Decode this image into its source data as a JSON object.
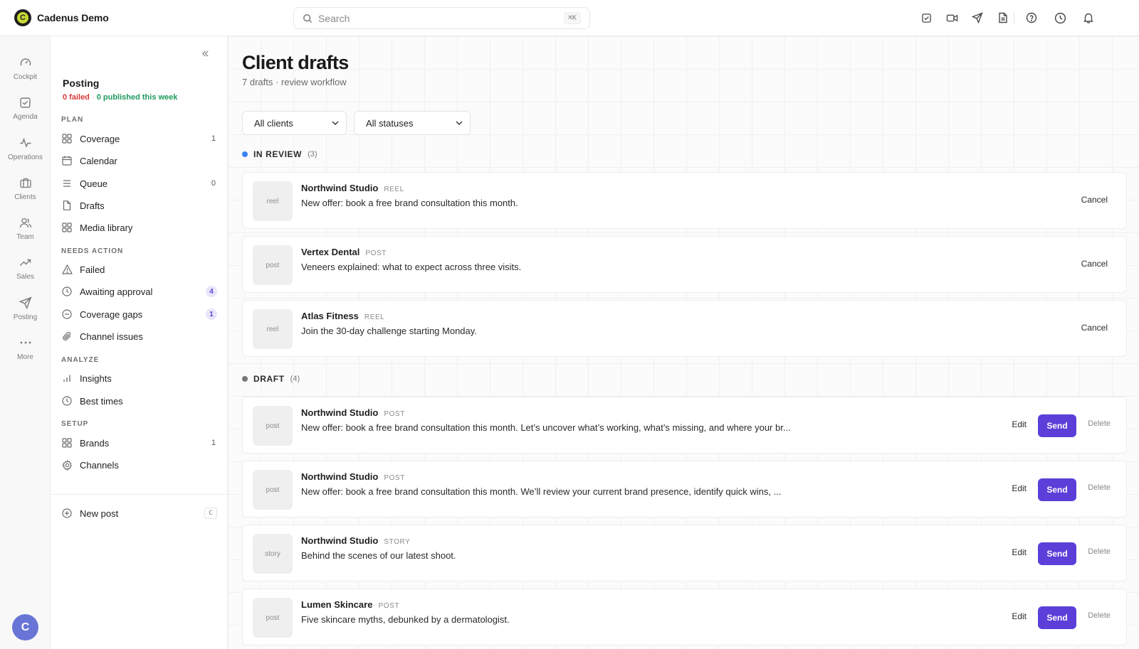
{
  "app": {
    "name": "Cadenus Demo",
    "logo_letter": "C",
    "accent": "#5b3fd8"
  },
  "search": {
    "placeholder": "Search",
    "shortcut": "⌘K"
  },
  "topbar_icons": [
    "checkbox-icon",
    "video-icon",
    "send-icon",
    "document-icon",
    "help-icon",
    "clock-icon",
    "bell-icon"
  ],
  "rail": {
    "items": [
      {
        "label": "Cockpit",
        "icon": "gauge-icon"
      },
      {
        "label": "Agenda",
        "icon": "checkbox-icon"
      },
      {
        "label": "Operations",
        "icon": "activity-icon"
      },
      {
        "label": "Clients",
        "icon": "briefcase-icon"
      },
      {
        "label": "Team",
        "icon": "users-icon"
      },
      {
        "label": "Sales",
        "icon": "trending-up-icon"
      },
      {
        "label": "Posting",
        "icon": "send-icon"
      },
      {
        "label": "More",
        "icon": "more-icon"
      }
    ],
    "avatar": "C"
  },
  "sidebar": {
    "title": "Posting",
    "failed": "0 failed",
    "separator": "·",
    "published": "0 published this week",
    "sections": [
      {
        "heading": "PLAN",
        "items": [
          {
            "label": "Coverage",
            "icon": "grid-icon",
            "count": "1"
          },
          {
            "label": "Calendar",
            "icon": "calendar-icon",
            "count": ""
          },
          {
            "label": "Queue",
            "icon": "list-icon",
            "count": "0"
          },
          {
            "label": "Drafts",
            "icon": "file-icon",
            "count": ""
          },
          {
            "label": "Media library",
            "icon": "grid-icon",
            "count": ""
          }
        ]
      },
      {
        "heading": "NEEDS ACTION",
        "items": [
          {
            "label": "Failed",
            "icon": "warning-icon",
            "count": ""
          },
          {
            "label": "Awaiting approval",
            "icon": "clock-icon",
            "count": "4"
          },
          {
            "label": "Coverage gaps",
            "icon": "minus-circle-icon",
            "count": "1"
          },
          {
            "label": "Channel issues",
            "icon": "paperclip-icon",
            "count": ""
          }
        ]
      },
      {
        "heading": "ANALYZE",
        "items": [
          {
            "label": "Insights",
            "icon": "bar-chart-icon",
            "count": ""
          },
          {
            "label": "Best times",
            "icon": "clock-icon",
            "count": ""
          }
        ]
      },
      {
        "heading": "SETUP",
        "items": [
          {
            "label": "Brands",
            "icon": "grid-icon",
            "count": "1"
          },
          {
            "label": "Channels",
            "icon": "gear-icon",
            "count": ""
          }
        ]
      }
    ],
    "new_post": {
      "label": "New post",
      "shortcut": "C"
    }
  },
  "main": {
    "title": "Client drafts",
    "subtitle": "7 drafts · review workflow",
    "filters": [
      {
        "value": "All clients"
      },
      {
        "value": "All statuses"
      }
    ],
    "groups": [
      {
        "label": "IN REVIEW",
        "count": "(3)",
        "dot_color": "#3b82f6",
        "items": [
          {
            "thumb": "reel",
            "client": "Northwind Studio",
            "type": "REEL",
            "text": "New offer: book a free brand consultation this month.",
            "action": "Cancel"
          },
          {
            "thumb": "post",
            "client": "Vertex Dental",
            "type": "POST",
            "text": "Veneers explained: what to expect across three visits.",
            "action": "Cancel"
          },
          {
            "thumb": "reel",
            "client": "Atlas Fitness",
            "type": "REEL",
            "text": "Join the 30-day challenge starting Monday.",
            "action": "Cancel"
          }
        ]
      },
      {
        "label": "DRAFT",
        "count": "(4)",
        "dot_color": "#777777",
        "items": [
          {
            "thumb": "post",
            "client": "Northwind Studio",
            "type": "POST",
            "text": "New offer: book a free brand consultation this month. Let’s uncover what’s working, what’s missing, and where your br...",
            "edit": "Edit",
            "send": "Send",
            "delete": "Delete"
          },
          {
            "thumb": "post",
            "client": "Northwind Studio",
            "type": "POST",
            "text": "New offer: book a free brand consultation this month. We’ll review your current brand presence, identify quick wins, ...",
            "edit": "Edit",
            "send": "Send",
            "delete": "Delete"
          },
          {
            "thumb": "story",
            "client": "Northwind Studio",
            "type": "STORY",
            "text": "Behind the scenes of our latest shoot.",
            "edit": "Edit",
            "send": "Send",
            "delete": "Delete"
          },
          {
            "thumb": "post",
            "client": "Lumen Skincare",
            "type": "POST",
            "text": "Five skincare myths, debunked by a dermatologist.",
            "edit": "Edit",
            "send": "Send",
            "delete": "Delete"
          }
        ]
      }
    ]
  }
}
